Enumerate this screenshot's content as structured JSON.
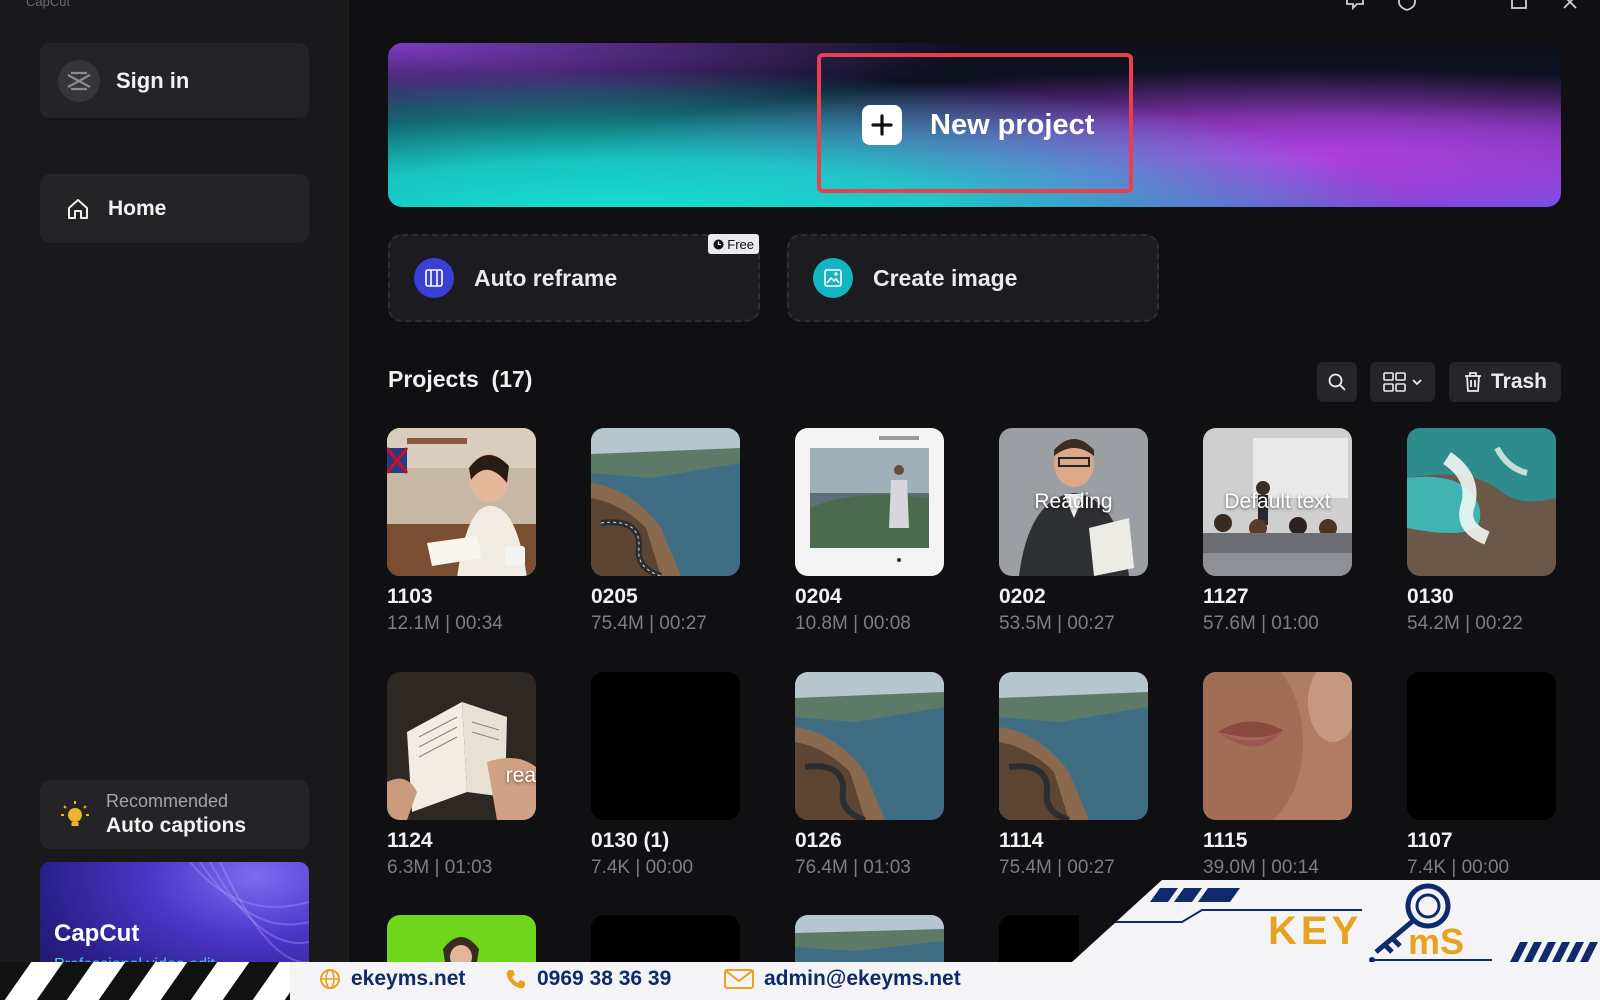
{
  "app": {
    "title": "CapCut"
  },
  "sidebar": {
    "sign_in_label": "Sign in",
    "nav": [
      {
        "label": "Home",
        "icon": "home-icon"
      }
    ],
    "recommended": {
      "kicker": "Recommended",
      "title": "Auto captions"
    },
    "promo": {
      "title": "CapCut",
      "subtitle": "Professional video edit"
    }
  },
  "hero": {
    "new_project_label": "New project"
  },
  "tools": [
    {
      "label": "Auto reframe",
      "badge": "Free",
      "icon": "auto-reframe-icon",
      "icon_color": "#3a3fd6"
    },
    {
      "label": "Create image",
      "icon": "image-icon",
      "icon_color": "#13b5c4"
    }
  ],
  "projects": {
    "title": "Projects",
    "count": "(17)",
    "trash_label": "Trash",
    "items": [
      {
        "name": "1103",
        "meta": "12.1M | 00:34",
        "thumb": "woman-reading"
      },
      {
        "name": "0205",
        "meta": "75.4M | 00:27",
        "thumb": "coastal-road"
      },
      {
        "name": "0204",
        "meta": "10.8M | 00:08",
        "thumb": "editor-screenshot"
      },
      {
        "name": "0202",
        "meta": "53.5M | 00:27",
        "thumb": "man-reading",
        "overlay": "Reading"
      },
      {
        "name": "1127",
        "meta": "57.6M | 01:00",
        "thumb": "classroom",
        "overlay": "Default text"
      },
      {
        "name": "0130",
        "meta": "54.2M | 00:22",
        "thumb": "ocean-waves"
      },
      {
        "name": "1124",
        "meta": "6.3M | 01:03",
        "thumb": "book-hands",
        "overlay": "rea"
      },
      {
        "name": "0130 (1)",
        "meta": "7.4K | 00:00",
        "thumb": "black"
      },
      {
        "name": "0126",
        "meta": "76.4M | 01:03",
        "thumb": "coastal-road"
      },
      {
        "name": "1114",
        "meta": "75.4M | 00:27",
        "thumb": "coastal-road"
      },
      {
        "name": "1115",
        "meta": "39.0M | 00:14",
        "thumb": "lips-closeup"
      },
      {
        "name": "1107",
        "meta": "7.4K | 00:00",
        "thumb": "black"
      }
    ]
  },
  "watermark": {
    "website": "ekeyms.net",
    "phone": "0969 38 36 39",
    "email": "admin@ekeyms.net",
    "logo_text": "KEYMS"
  },
  "colors": {
    "accent_red": "#e8414a",
    "brand_navy": "#0f2a6b",
    "brand_gold": "#e6a321"
  }
}
